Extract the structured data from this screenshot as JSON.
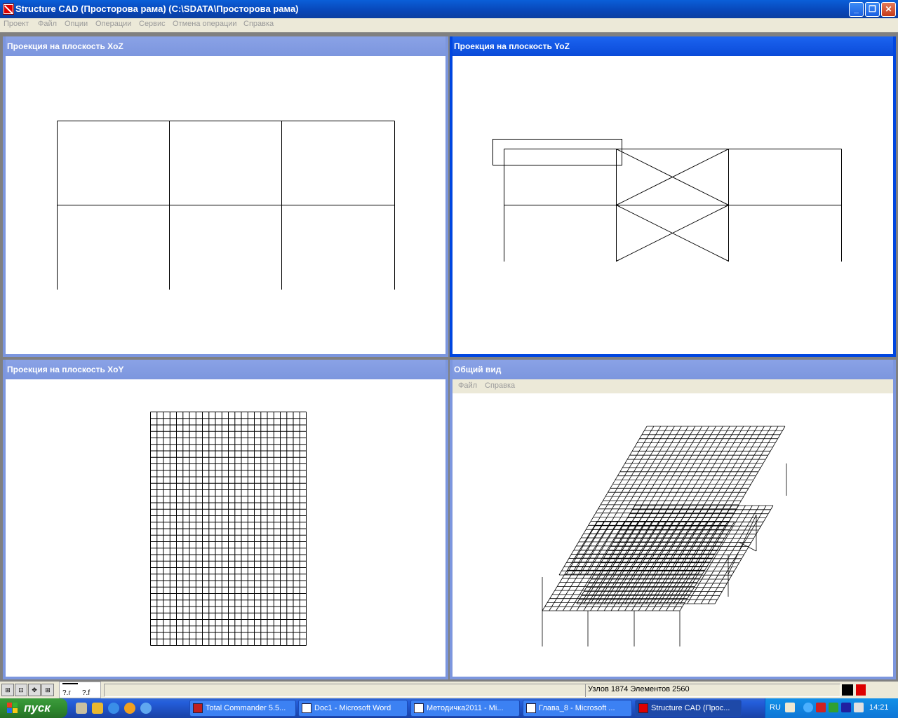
{
  "window": {
    "title": "Structure CAD (Просторова рама) (C:\\SDATA\\Просторова рама)",
    "min_label": "_",
    "max_label": "❐",
    "close_label": "✕"
  },
  "menu": [
    "Проект",
    "Файл",
    "Опции",
    "Операции",
    "Сервис",
    "Отмена операции",
    "Справка"
  ],
  "children": {
    "xoz": {
      "title": "Проекция на плоскость XoZ"
    },
    "yoz": {
      "title": "Проекция на плоскость YoZ"
    },
    "xoy": {
      "title": "Проекция на плоскость XoY"
    },
    "general": {
      "title": "Общий вид",
      "menu": [
        "Файл",
        "Справка"
      ]
    }
  },
  "toolbar_icons": [
    "fit-icon",
    "zoom-icon",
    "move-icon",
    "select-icon"
  ],
  "status": {
    "text": "Узлов 1874 Элементов 2560"
  },
  "taskbar": {
    "start_label": "пуск",
    "buttons": [
      "Total Commander 5.5...",
      "Doc1 - Microsoft Word",
      "Методичка2011 - Mi...",
      "Глава_8 - Microsoft ...",
      "Structure CAD (Прос..."
    ],
    "lang": "RU",
    "clock": "14:21"
  },
  "colors": {
    "title_active": "#0a4ad8",
    "title_inactive": "#7c96de",
    "taskbar": "#245edb",
    "start": "#2f8a2f"
  }
}
